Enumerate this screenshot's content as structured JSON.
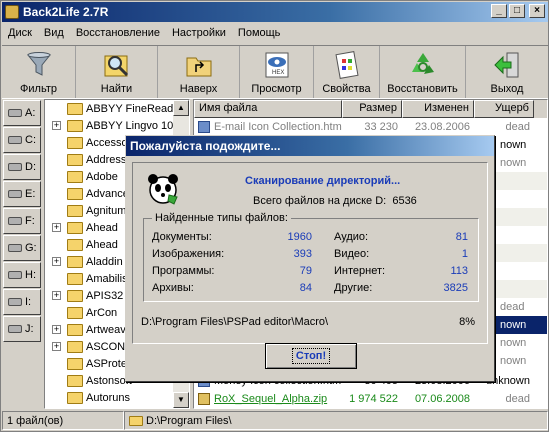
{
  "window": {
    "title": "Back2Life 2.7R",
    "min": "_",
    "max": "□",
    "close": "×"
  },
  "menu": [
    "Диск",
    "Вид",
    "Восстановление",
    "Настройки",
    "Помощь"
  ],
  "toolbar": [
    {
      "label": "Фильтр",
      "icon": "funnel-icon",
      "color": "#8a9aa8"
    },
    {
      "label": "Найти",
      "icon": "find-icon",
      "color": "#e9c44c"
    },
    {
      "label": "Наверх",
      "icon": "folder-up-icon",
      "color": "#f1d27a"
    },
    {
      "label": "Просмотр",
      "icon": "hex-viewer-icon",
      "color": "#3b6fb8"
    },
    {
      "label": "Свойства",
      "icon": "properties-icon",
      "color": "#c8a060"
    },
    {
      "label": "Восстановить",
      "icon": "recycle-icon",
      "color": "#3aa83a"
    },
    {
      "label": "Выход",
      "icon": "exit-icon",
      "color": "#3cbf3c"
    }
  ],
  "drives": [
    "A:",
    "C:",
    "D:",
    "E:",
    "F:",
    "G:",
    "H:",
    "I:",
    "J:"
  ],
  "tree": [
    {
      "name": "ABBYY FineReader",
      "exp": false
    },
    {
      "name": "ABBYY Lingvo 10",
      "exp": true
    },
    {
      "name": "Accessories",
      "exp": false
    },
    {
      "name": "Address",
      "exp": false
    },
    {
      "name": "Adobe",
      "exp": false
    },
    {
      "name": "Advanced",
      "exp": false
    },
    {
      "name": "Agnitum",
      "exp": false
    },
    {
      "name": "Ahead",
      "exp": true
    },
    {
      "name": "Ahead",
      "exp": false
    },
    {
      "name": "Aladdin",
      "exp": true
    },
    {
      "name": "Amabilis",
      "exp": false
    },
    {
      "name": "APIS32",
      "exp": true
    },
    {
      "name": "ArCon",
      "exp": false
    },
    {
      "name": "Artweaver",
      "exp": true
    },
    {
      "name": "ASCON",
      "exp": true
    },
    {
      "name": "ASProtect",
      "exp": false
    },
    {
      "name": "Astonsoft",
      "exp": false
    },
    {
      "name": "Autoruns",
      "exp": false
    }
  ],
  "files": {
    "headers": [
      "Имя файла",
      "Размер",
      "Изменен",
      "Ущерб"
    ],
    "rows": [
      {
        "name": "E-mail Icon Collection.htm",
        "size": "33 230",
        "date": "23.08.2006",
        "damage": "dead",
        "style": "gray"
      },
      {
        "name": "Money Icon collection.htm",
        "size": "30 405",
        "date": "23.08.2006",
        "damage": "unknown",
        "style": "normal"
      },
      {
        "name": "RoX_Sequel_Alpha.zip",
        "size": "1 974 522",
        "date": "07.06.2008",
        "damage": "dead",
        "style": "green"
      }
    ]
  },
  "status": {
    "count": "1 файл(ов)",
    "path": "D:\\Program Files\\"
  },
  "dialog": {
    "title": "Пожалуйста подождите...",
    "scanning": "Сканирование директорий...",
    "total_label": "Всего файлов на диске D:",
    "total_value": "6536",
    "group_label": "Найденные типы файлов:",
    "stats": [
      {
        "label": "Документы:",
        "value": "1960"
      },
      {
        "label": "Аудио:",
        "value": "81"
      },
      {
        "label": "Изображения:",
        "value": "393"
      },
      {
        "label": "Видео:",
        "value": "1"
      },
      {
        "label": "Программы:",
        "value": "79"
      },
      {
        "label": "Интернет:",
        "value": "113"
      },
      {
        "label": "Архивы:",
        "value": "84"
      },
      {
        "label": "Другие:",
        "value": "3825"
      }
    ],
    "path": "D:\\Program Files\\PSPad editor\\Macro\\",
    "percent": "8%",
    "stop_label": "Стоп!"
  }
}
